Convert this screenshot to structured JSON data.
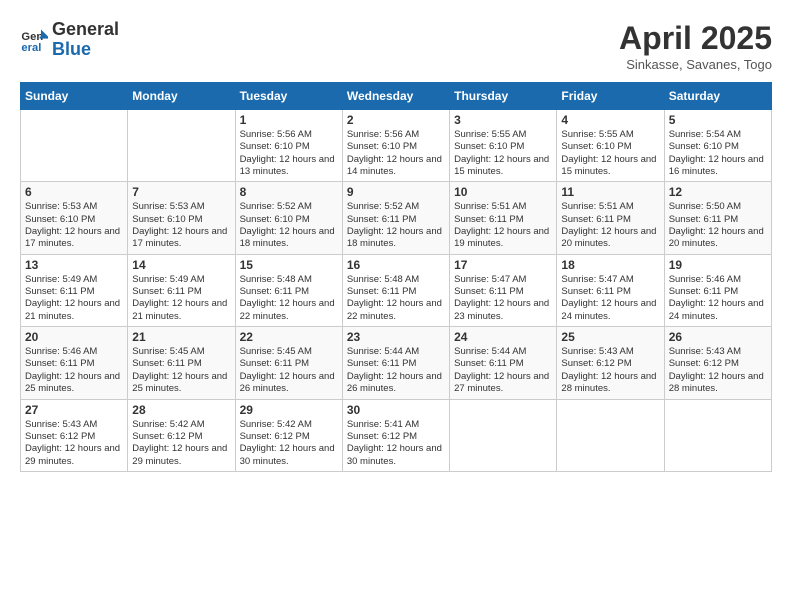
{
  "header": {
    "logo_general": "General",
    "logo_blue": "Blue",
    "month_title": "April 2025",
    "subtitle": "Sinkasse, Savanes, Togo"
  },
  "days_of_week": [
    "Sunday",
    "Monday",
    "Tuesday",
    "Wednesday",
    "Thursday",
    "Friday",
    "Saturday"
  ],
  "weeks": [
    [
      {
        "day": "",
        "info": ""
      },
      {
        "day": "",
        "info": ""
      },
      {
        "day": "1",
        "info": "Sunrise: 5:56 AM\nSunset: 6:10 PM\nDaylight: 12 hours and 13 minutes."
      },
      {
        "day": "2",
        "info": "Sunrise: 5:56 AM\nSunset: 6:10 PM\nDaylight: 12 hours and 14 minutes."
      },
      {
        "day": "3",
        "info": "Sunrise: 5:55 AM\nSunset: 6:10 PM\nDaylight: 12 hours and 15 minutes."
      },
      {
        "day": "4",
        "info": "Sunrise: 5:55 AM\nSunset: 6:10 PM\nDaylight: 12 hours and 15 minutes."
      },
      {
        "day": "5",
        "info": "Sunrise: 5:54 AM\nSunset: 6:10 PM\nDaylight: 12 hours and 16 minutes."
      }
    ],
    [
      {
        "day": "6",
        "info": "Sunrise: 5:53 AM\nSunset: 6:10 PM\nDaylight: 12 hours and 17 minutes."
      },
      {
        "day": "7",
        "info": "Sunrise: 5:53 AM\nSunset: 6:10 PM\nDaylight: 12 hours and 17 minutes."
      },
      {
        "day": "8",
        "info": "Sunrise: 5:52 AM\nSunset: 6:10 PM\nDaylight: 12 hours and 18 minutes."
      },
      {
        "day": "9",
        "info": "Sunrise: 5:52 AM\nSunset: 6:11 PM\nDaylight: 12 hours and 18 minutes."
      },
      {
        "day": "10",
        "info": "Sunrise: 5:51 AM\nSunset: 6:11 PM\nDaylight: 12 hours and 19 minutes."
      },
      {
        "day": "11",
        "info": "Sunrise: 5:51 AM\nSunset: 6:11 PM\nDaylight: 12 hours and 20 minutes."
      },
      {
        "day": "12",
        "info": "Sunrise: 5:50 AM\nSunset: 6:11 PM\nDaylight: 12 hours and 20 minutes."
      }
    ],
    [
      {
        "day": "13",
        "info": "Sunrise: 5:49 AM\nSunset: 6:11 PM\nDaylight: 12 hours and 21 minutes."
      },
      {
        "day": "14",
        "info": "Sunrise: 5:49 AM\nSunset: 6:11 PM\nDaylight: 12 hours and 21 minutes."
      },
      {
        "day": "15",
        "info": "Sunrise: 5:48 AM\nSunset: 6:11 PM\nDaylight: 12 hours and 22 minutes."
      },
      {
        "day": "16",
        "info": "Sunrise: 5:48 AM\nSunset: 6:11 PM\nDaylight: 12 hours and 22 minutes."
      },
      {
        "day": "17",
        "info": "Sunrise: 5:47 AM\nSunset: 6:11 PM\nDaylight: 12 hours and 23 minutes."
      },
      {
        "day": "18",
        "info": "Sunrise: 5:47 AM\nSunset: 6:11 PM\nDaylight: 12 hours and 24 minutes."
      },
      {
        "day": "19",
        "info": "Sunrise: 5:46 AM\nSunset: 6:11 PM\nDaylight: 12 hours and 24 minutes."
      }
    ],
    [
      {
        "day": "20",
        "info": "Sunrise: 5:46 AM\nSunset: 6:11 PM\nDaylight: 12 hours and 25 minutes."
      },
      {
        "day": "21",
        "info": "Sunrise: 5:45 AM\nSunset: 6:11 PM\nDaylight: 12 hours and 25 minutes."
      },
      {
        "day": "22",
        "info": "Sunrise: 5:45 AM\nSunset: 6:11 PM\nDaylight: 12 hours and 26 minutes."
      },
      {
        "day": "23",
        "info": "Sunrise: 5:44 AM\nSunset: 6:11 PM\nDaylight: 12 hours and 26 minutes."
      },
      {
        "day": "24",
        "info": "Sunrise: 5:44 AM\nSunset: 6:11 PM\nDaylight: 12 hours and 27 minutes."
      },
      {
        "day": "25",
        "info": "Sunrise: 5:43 AM\nSunset: 6:12 PM\nDaylight: 12 hours and 28 minutes."
      },
      {
        "day": "26",
        "info": "Sunrise: 5:43 AM\nSunset: 6:12 PM\nDaylight: 12 hours and 28 minutes."
      }
    ],
    [
      {
        "day": "27",
        "info": "Sunrise: 5:43 AM\nSunset: 6:12 PM\nDaylight: 12 hours and 29 minutes."
      },
      {
        "day": "28",
        "info": "Sunrise: 5:42 AM\nSunset: 6:12 PM\nDaylight: 12 hours and 29 minutes."
      },
      {
        "day": "29",
        "info": "Sunrise: 5:42 AM\nSunset: 6:12 PM\nDaylight: 12 hours and 30 minutes."
      },
      {
        "day": "30",
        "info": "Sunrise: 5:41 AM\nSunset: 6:12 PM\nDaylight: 12 hours and 30 minutes."
      },
      {
        "day": "",
        "info": ""
      },
      {
        "day": "",
        "info": ""
      },
      {
        "day": "",
        "info": ""
      }
    ]
  ]
}
